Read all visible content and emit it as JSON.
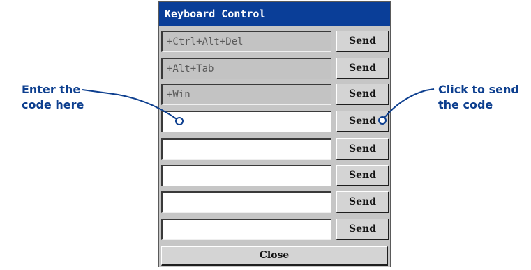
{
  "panel": {
    "title": "Keyboard Control",
    "rows": [
      {
        "code": "+Ctrl+Alt+Del",
        "send_label": "Send"
      },
      {
        "code": "+Alt+Tab",
        "send_label": "Send"
      },
      {
        "code": "+Win",
        "send_label": "Send"
      },
      {
        "code": "",
        "send_label": "Send"
      },
      {
        "code": "",
        "send_label": "Send"
      },
      {
        "code": "",
        "send_label": "Send"
      },
      {
        "code": "",
        "send_label": "Send"
      },
      {
        "code": "",
        "send_label": "Send"
      }
    ],
    "close_label": "Close"
  },
  "callouts": {
    "left_line1": "Enter the",
    "left_line2": "code here",
    "right_line1": "Click to send",
    "right_line2": "the code"
  },
  "colors": {
    "title_bar": "#0a3e98",
    "callout": "#0d3f8f",
    "panel_bg": "#c6c6c6"
  }
}
